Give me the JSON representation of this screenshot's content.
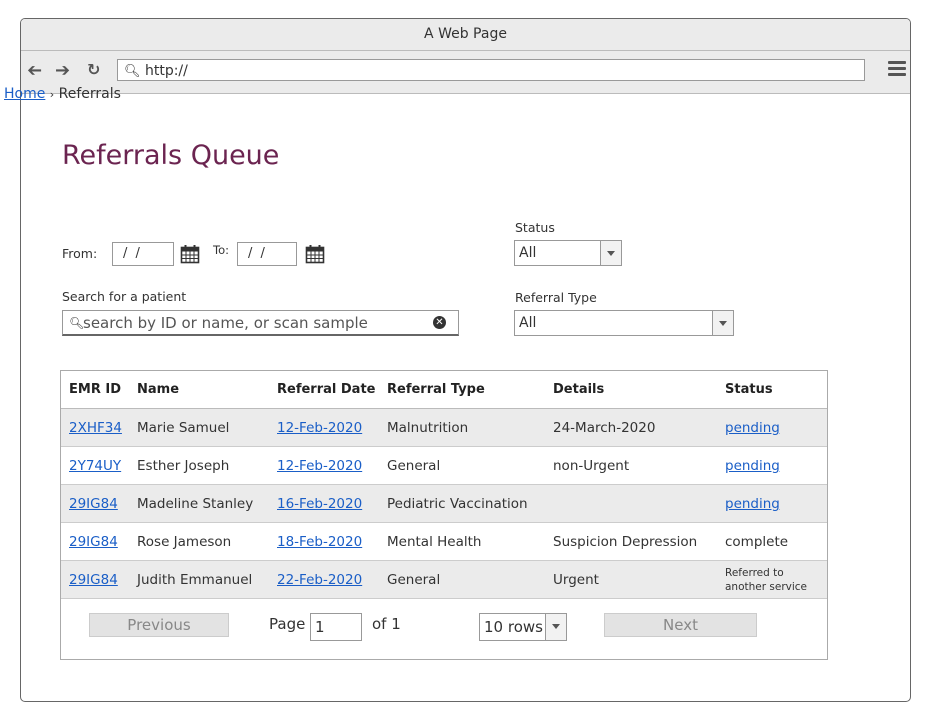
{
  "window": {
    "title": "A Web Page"
  },
  "browser": {
    "url": "http://"
  },
  "breadcrumb": {
    "home": "Home",
    "separator": "›",
    "current": "Referrals"
  },
  "page": {
    "title": "Referrals Queue"
  },
  "filters": {
    "from_label": "From:",
    "from_value": "/ /",
    "to_label": "To:",
    "to_value": "/ /",
    "status_label": "Status",
    "status_value": "All",
    "search_label": "Search for a patient",
    "search_placeholder": "search by ID or name, or scan sample",
    "referral_type_label": "Referral Type",
    "referral_type_value": "All"
  },
  "table": {
    "headers": [
      "EMR ID",
      "Name",
      "Referral Date",
      "Referral Type",
      "Details",
      "Status"
    ],
    "rows": [
      {
        "emr": "2XHF34",
        "name": "Marie Samuel",
        "date": "12-Feb-2020",
        "type": "Malnutrition",
        "details": "24-March-2020",
        "status": "pending",
        "status_link": true
      },
      {
        "emr": "2Y74UY",
        "name": "Esther Joseph",
        "date": "12-Feb-2020",
        "type": "General",
        "details": "non-Urgent",
        "status": "pending",
        "status_link": true
      },
      {
        "emr": "29IG84",
        "name": "Madeline Stanley",
        "date": "16-Feb-2020",
        "type": "Pediatric Vaccination",
        "details": "",
        "status": "pending",
        "status_link": true
      },
      {
        "emr": "29IG84",
        "name": "Rose Jameson",
        "date": "18-Feb-2020",
        "type": "Mental Health",
        "details": "Suspicion Depression",
        "status": "complete",
        "status_link": false
      },
      {
        "emr": "29IG84",
        "name": "Judith Emmanuel",
        "date": "22-Feb-2020",
        "type": "General",
        "details": "Urgent",
        "status": "Referred to another service",
        "status_link": false
      }
    ]
  },
  "pagination": {
    "previous": "Previous",
    "page_label": "Page",
    "page_value": "1",
    "of_label": "of 1",
    "rows_value": "10 rows",
    "next": "Next"
  }
}
